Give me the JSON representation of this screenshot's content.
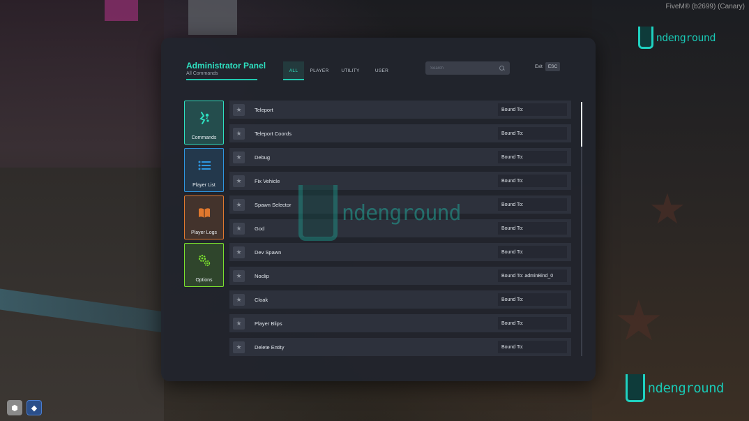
{
  "overlay": {
    "fivem_label": "FiveM® (b2699) (Canary) ",
    "brand_text": "ndenground",
    "watermark_text": "ndenground"
  },
  "panel": {
    "title": "Administrator Panel",
    "subtitle": "All Commands",
    "tabs": [
      {
        "label": "ALL",
        "active": true
      },
      {
        "label": "PLAYER",
        "active": false
      },
      {
        "label": "UTILITY",
        "active": false
      },
      {
        "label": "USER",
        "active": false
      }
    ],
    "search": {
      "placeholder": "Search",
      "value": ""
    },
    "exit_label": "Exit",
    "esc_label": "ESC"
  },
  "sidebar": {
    "items": [
      {
        "label": "Commands",
        "icon": "commands-icon",
        "color": "#2ee0c0"
      },
      {
        "label": "Player List",
        "icon": "list-icon",
        "color": "#2e96e0"
      },
      {
        "label": "Player Logs",
        "icon": "book-icon",
        "color": "#e0782e"
      },
      {
        "label": "Options",
        "icon": "gears-icon",
        "color": "#7ae02e"
      }
    ]
  },
  "commands": [
    {
      "name": "Teleport",
      "bound": "Bound To:"
    },
    {
      "name": "Teleport Coords",
      "bound": "Bound To:"
    },
    {
      "name": "Debug",
      "bound": "Bound To:"
    },
    {
      "name": "Fix Vehicle",
      "bound": "Bound To:"
    },
    {
      "name": "Spawn Selector",
      "bound": "Bound To:"
    },
    {
      "name": "God",
      "bound": "Bound To:"
    },
    {
      "name": "Dev Spawn",
      "bound": "Bound To:"
    },
    {
      "name": "Noclip",
      "bound": "Bound To: adminBind_0"
    },
    {
      "name": "Cloak",
      "bound": "Bound To:"
    },
    {
      "name": "Player Blips",
      "bound": "Bound To:"
    },
    {
      "name": "Delete Entity",
      "bound": "Bound To:"
    }
  ],
  "colors": {
    "accent": "#2ee0c0",
    "panel_bg": "#21242d",
    "row_bg": "#2d313c"
  }
}
